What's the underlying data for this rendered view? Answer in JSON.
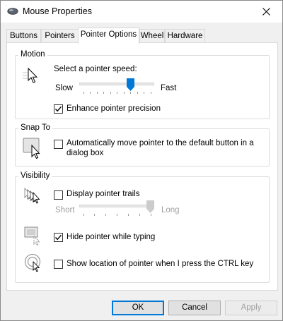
{
  "window": {
    "title": "Mouse Properties",
    "icon": "mouse-icon"
  },
  "tabs": [
    {
      "label": "Buttons",
      "active": false
    },
    {
      "label": "Pointers",
      "active": false
    },
    {
      "label": "Pointer Options",
      "active": true
    },
    {
      "label": "Wheel",
      "active": false
    },
    {
      "label": "Hardware",
      "active": false
    }
  ],
  "motion": {
    "group_label": "Motion",
    "speed_label": "Select a pointer speed:",
    "slow_label": "Slow",
    "fast_label": "Fast",
    "speed_level": 0.7,
    "enhance_label": "Enhance pointer precision",
    "enhance_checked": true
  },
  "snap_to": {
    "group_label": "Snap To",
    "option_line1": "Automatically move pointer to the default button in a",
    "option_line2": "dialog box",
    "checked": false
  },
  "visibility": {
    "group_label": "Visibility",
    "trails_label": "Display pointer trails",
    "trails_checked": false,
    "short_label": "Short",
    "long_label": "Long",
    "trails_level": 1.0,
    "hide_label": "Hide pointer while typing",
    "hide_checked": true,
    "show_ctrl_label": "Show location of pointer when I press the CTRL key",
    "show_ctrl_checked": false
  },
  "buttons": {
    "ok": "OK",
    "cancel": "Cancel",
    "apply": "Apply"
  },
  "colors": {
    "accent": "#0078d7",
    "disabled_text": "#a0a0a0"
  }
}
